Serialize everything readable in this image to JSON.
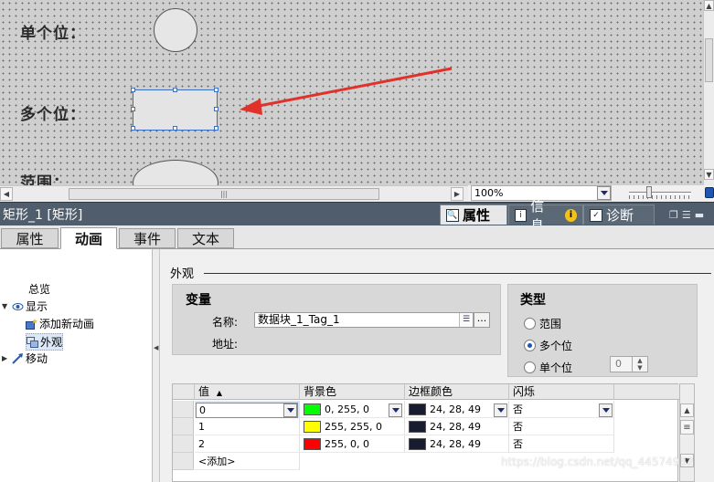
{
  "canvas": {
    "labels": {
      "single": "单个位：",
      "multi": "多个位：",
      "range": "范围："
    }
  },
  "view": {
    "zoom": "100%"
  },
  "inspector": {
    "title": "矩形_1 [矩形]",
    "header_tabs": {
      "properties": "属性",
      "info": "信息",
      "diagnostics": "诊断"
    },
    "sub_tabs": {
      "properties": "属性",
      "animation": "动画",
      "events": "事件",
      "text": "文本"
    }
  },
  "tree": {
    "overview": "总览",
    "display": "显示",
    "add_animation": "添加新动画",
    "appearance": "外观",
    "move": "移动"
  },
  "appearance": {
    "section_title": "外观",
    "variable": {
      "title": "变量",
      "name_label": "名称:",
      "name_value": "数据块_1_Tag_1",
      "address_label": "地址:",
      "more_button": "..."
    },
    "type": {
      "title": "类型",
      "options": [
        "范围",
        "多个位",
        "单个位"
      ],
      "selected": "多个位",
      "bit_value": "0"
    },
    "table": {
      "headers": [
        "值",
        "背景色",
        "边框颜色",
        "闪烁"
      ],
      "sort_indicator": "▲",
      "rows": [
        {
          "value": "0",
          "bg": "0, 255, 0",
          "bg_color": "#00ff00",
          "border": "24, 28, 49",
          "border_color": "#181c31",
          "blink": "否"
        },
        {
          "value": "1",
          "bg": "255, 255, 0",
          "bg_color": "#ffff00",
          "border": "24, 28, 49",
          "border_color": "#181c31",
          "blink": "否"
        },
        {
          "value": "2",
          "bg": "255, 0, 0",
          "bg_color": "#ff0000",
          "border": "24, 28, 49",
          "border_color": "#181c31",
          "blink": "否"
        }
      ],
      "add_row": "<添加>"
    }
  },
  "watermark": "https://blog.csdn.net/qq_44574932",
  "colors": {
    "accent": "#1e56b3",
    "selection": "#3a6fc4",
    "arrow": "#e0312b",
    "title_bar": "#4f5d6c"
  }
}
